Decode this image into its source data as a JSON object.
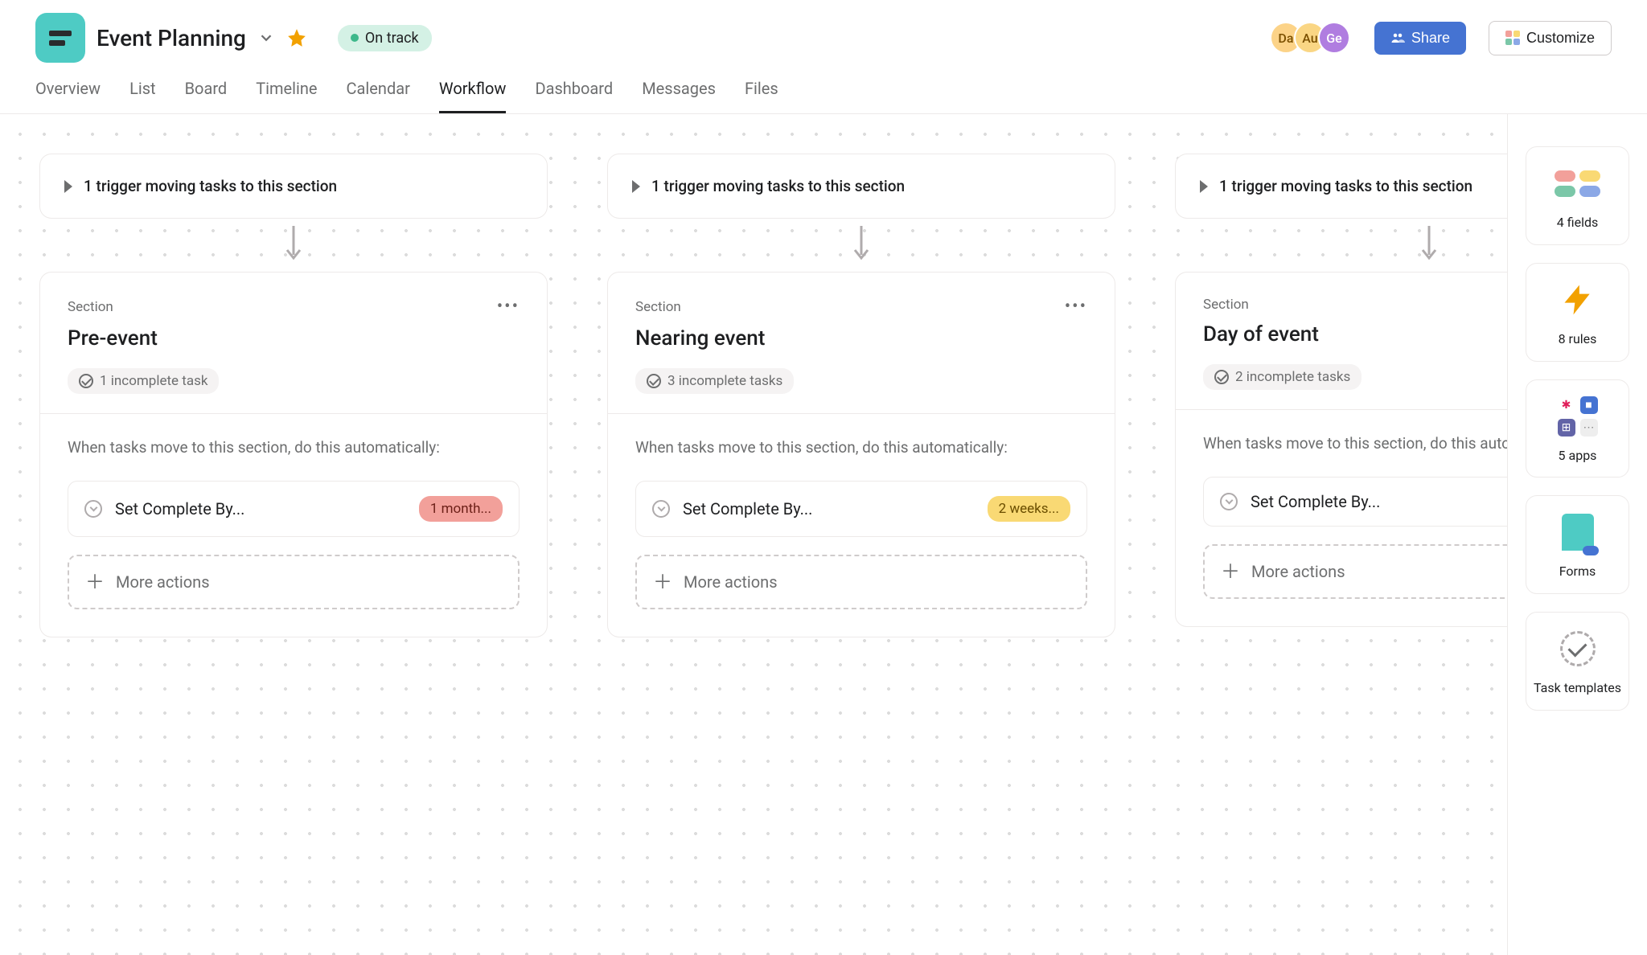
{
  "project": {
    "title": "Event Planning",
    "status": "On track"
  },
  "header": {
    "share_label": "Share",
    "customize_label": "Customize",
    "avatars": [
      {
        "initials": "Da",
        "bg": "#fcd388",
        "fg": "#7b5000"
      },
      {
        "initials": "Au",
        "bg": "#fad684",
        "fg": "#7b5000"
      },
      {
        "initials": "Ge",
        "bg": "#b07de0",
        "fg": "#fff"
      }
    ]
  },
  "tabs": [
    {
      "label": "Overview",
      "active": false
    },
    {
      "label": "List",
      "active": false
    },
    {
      "label": "Board",
      "active": false
    },
    {
      "label": "Timeline",
      "active": false
    },
    {
      "label": "Calendar",
      "active": false
    },
    {
      "label": "Workflow",
      "active": true
    },
    {
      "label": "Dashboard",
      "active": false
    },
    {
      "label": "Messages",
      "active": false
    },
    {
      "label": "Files",
      "active": false
    }
  ],
  "columns": [
    {
      "trigger": "1 trigger moving tasks to this section",
      "section_label": "Section",
      "title": "Pre-event",
      "incomplete": "1 incomplete task",
      "auto_text": "When tasks move to this section, do this automatically:",
      "rule_label": "Set Complete By...",
      "rule_pill": "1 month...",
      "rule_pill_bg": "#f2a09a",
      "rule_pill_fg": "#6b1f17",
      "more": "More actions"
    },
    {
      "trigger": "1 trigger moving tasks to this section",
      "section_label": "Section",
      "title": "Nearing event",
      "incomplete": "3 incomplete tasks",
      "auto_text": "When tasks move to this section, do this automatically:",
      "rule_label": "Set Complete By...",
      "rule_pill": "2 weeks...",
      "rule_pill_bg": "#f9d974",
      "rule_pill_fg": "#6b4e00",
      "more": "More actions"
    },
    {
      "trigger": "1 trigger moving tasks to this section",
      "section_label": "Section",
      "title": "Day of event",
      "incomplete": "2 incomplete tasks",
      "auto_text": "When tasks move to this section, do this automatically:",
      "rule_label": "Set Complete By...",
      "rule_pill": "",
      "rule_pill_bg": "",
      "rule_pill_fg": "",
      "more": "More actions"
    }
  ],
  "sidebar": {
    "fields": "4 fields",
    "rules": "8 rules",
    "apps": "5 apps",
    "forms": "Forms",
    "templates": "Task templates"
  }
}
